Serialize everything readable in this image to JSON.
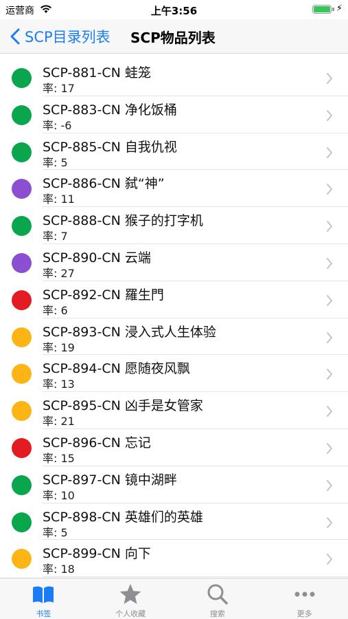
{
  "status_bar": {
    "carrier": "运营商",
    "time": "上午3:56"
  },
  "nav": {
    "back_label": "SCP目录列表",
    "title": "SCP物品列表"
  },
  "colors": {
    "accent": "#1a7cf6",
    "green": "#0aa64e",
    "purple": "#8c4fd2",
    "red": "#e31b23",
    "yellow": "#fdb515"
  },
  "items": [
    {
      "title": "SCP-881-CN 蛙笼",
      "rate": "率: 17",
      "class_color": "green"
    },
    {
      "title": "SCP-883-CN 净化饭桶",
      "rate": "率: -6",
      "class_color": "green"
    },
    {
      "title": "SCP-885-CN 自我仇视",
      "rate": "率: 5",
      "class_color": "green"
    },
    {
      "title": "SCP-886-CN 弑“神”",
      "rate": "率: 11",
      "class_color": "purple"
    },
    {
      "title": "SCP-888-CN 猴子的打字机",
      "rate": "率: 7",
      "class_color": "green"
    },
    {
      "title": "SCP-890-CN 云端",
      "rate": "率: 27",
      "class_color": "purple"
    },
    {
      "title": "SCP-892-CN 羅生門",
      "rate": "率: 6",
      "class_color": "red"
    },
    {
      "title": "SCP-893-CN 浸入式人生体验",
      "rate": "率: 19",
      "class_color": "yellow"
    },
    {
      "title": "SCP-894-CN 愿随夜风飘",
      "rate": "率: 13",
      "class_color": "yellow"
    },
    {
      "title": "SCP-895-CN 凶手是女管家",
      "rate": "率: 21",
      "class_color": "yellow"
    },
    {
      "title": "SCP-896-CN 忘记",
      "rate": "率: 15",
      "class_color": "red"
    },
    {
      "title": "SCP-897-CN 镜中湖畔",
      "rate": "率: 10",
      "class_color": "green"
    },
    {
      "title": "SCP-898-CN 英雄们的英雄",
      "rate": "率: 5",
      "class_color": "green"
    },
    {
      "title": "SCP-899-CN 向下",
      "rate": "率: 18",
      "class_color": "yellow"
    }
  ],
  "tabs": [
    {
      "label": "书签",
      "icon": "book-icon",
      "active": true
    },
    {
      "label": "个人收藏",
      "icon": "star-icon",
      "active": false
    },
    {
      "label": "搜索",
      "icon": "search-icon",
      "active": false
    },
    {
      "label": "更多",
      "icon": "more-icon",
      "active": false
    }
  ]
}
